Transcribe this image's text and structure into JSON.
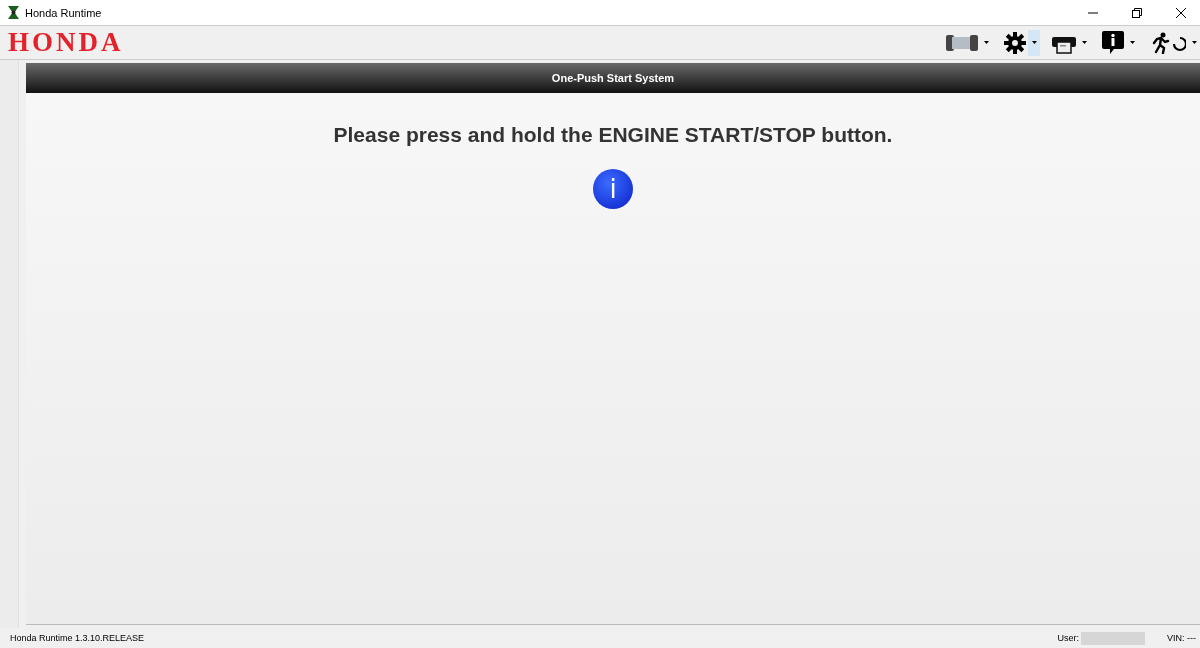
{
  "window": {
    "title": "Honda Runtime"
  },
  "logo": "HONDA",
  "toolbar": [
    {
      "kind": "connector",
      "selected": false
    },
    {
      "kind": "gear",
      "selected": true
    },
    {
      "kind": "printer",
      "selected": false
    },
    {
      "kind": "info",
      "selected": false
    },
    {
      "kind": "exit",
      "selected": false
    }
  ],
  "panel": {
    "title": "One-Push Start System",
    "message": "Please press and hold the ENGINE START/STOP button.",
    "info_symbol": "i"
  },
  "status_bar": {
    "version": "Honda Runtime 1.3.10.RELEASE",
    "user_label": "User:",
    "vin": "VIN: ---"
  }
}
